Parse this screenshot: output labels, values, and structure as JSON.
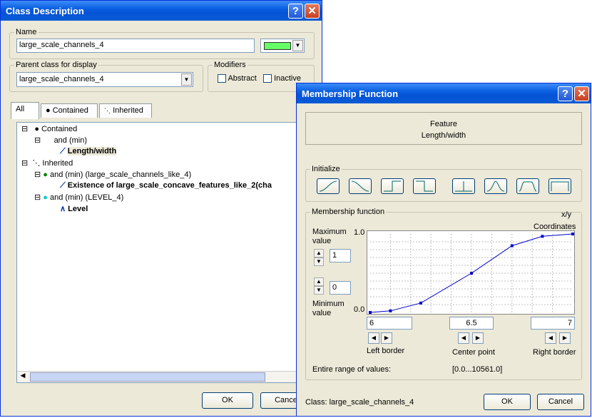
{
  "class_dialog": {
    "title": "Class Description",
    "name_label": "Name",
    "name_value": "large_scale_channels_4",
    "color": "#66ff66",
    "parent_label": "Parent class for display",
    "parent_value": "large_scale_channels_4",
    "modifiers_label": "Modifiers",
    "abstract_label": "Abstract",
    "inactive_label": "Inactive",
    "tabs": [
      "All",
      "Contained",
      "Inherited"
    ],
    "tree": {
      "contained": "Contained",
      "and_min": "and (min)",
      "length_width": "Length/width",
      "inherited": "Inherited",
      "and_min_channels": "and (min) (large_scale_channels_like_4)",
      "existence": "Existence of large_scale_concave_features_like_2(cha",
      "and_min_level": "and (min) (LEVEL_4)",
      "level": "Level"
    },
    "ok_label": "OK",
    "cancel_label": "Cance"
  },
  "mf_dialog": {
    "title": "Membership Function",
    "feature_label": "Feature",
    "feature_value": "Length/width",
    "initialize_label": "Initialize",
    "membership_label": "Membership function",
    "xy_label": "x/y",
    "coordinates_label": "Coordinates",
    "max_label": "Maximum value",
    "max_value": "1",
    "min_value": "0",
    "min_label": "Minimum value",
    "y_top": "1.0",
    "y_bottom": "0.0",
    "left_border_value": "6",
    "center_value": "6.5",
    "right_border_value": "7",
    "left_border_label": "Left border",
    "center_label": "Center point",
    "right_border_label": "Right border",
    "range_label": "Entire range of values:",
    "range_value": "[0.0...10561.0]",
    "class_label": "Class: large_scale_channels_4",
    "ok_label": "OK",
    "cancel_label": "Cancel"
  },
  "chart_data": {
    "type": "line",
    "x": [
      6.0,
      6.1,
      6.25,
      6.5,
      6.7,
      6.85,
      7.0
    ],
    "y": [
      0.0,
      0.02,
      0.12,
      0.5,
      0.85,
      0.97,
      1.0
    ],
    "xlim": [
      6,
      7
    ],
    "ylim": [
      0,
      1
    ],
    "grid": true
  }
}
